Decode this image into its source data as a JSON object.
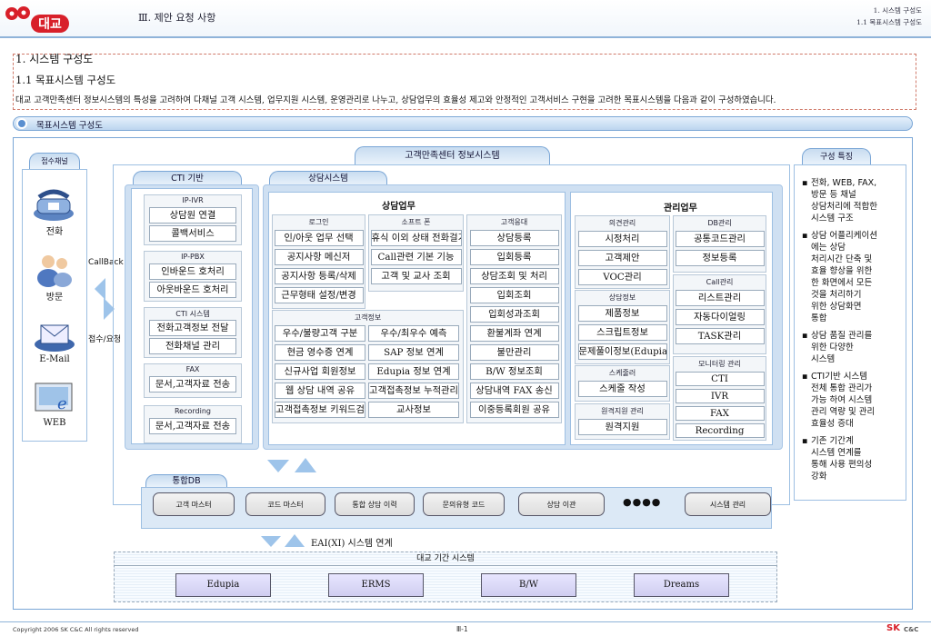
{
  "header": {
    "title": "Ⅲ. 제안 요청 사항",
    "right1": "1. 시스템 구성도",
    "right2": "1.1 목표시스템 구성도"
  },
  "intro": {
    "h1": "1. 시스템 구성도",
    "h2": "1.1 목표시스템 구성도",
    "para": "대교 고객만족센터 정보시스템의 특성을 고려하여 다채널 고객 시스템, 업무지원 시스템, 운영관리로 나누고, 상담업무의 효율성 제고와 안정적인 고객서비스 구현을 고려한 목표시스템을 다음과 같이 구성하였습니다."
  },
  "section_label": "목표시스템 구성도",
  "channels": {
    "title": "접수채널",
    "phone": "전화",
    "visit": "방문",
    "email": "E-Mail",
    "web": "WEB",
    "callback": "CallBack",
    "receive": "접수/요청"
  },
  "main_title": "고객만족센터 정보시스템",
  "cti": {
    "title": "CTI 기반",
    "groups": [
      {
        "name": "IP-IVR",
        "items": [
          "상담원 연결",
          "콜백서비스"
        ]
      },
      {
        "name": "IP-PBX",
        "items": [
          "인바운드 호처리",
          "아웃바운드 호처리"
        ]
      },
      {
        "name": "CTI 시스템",
        "items": [
          "전화고객정보 전달",
          "전화채널 관리"
        ]
      },
      {
        "name": "FAX",
        "items": [
          "문서,고객자료 전송"
        ]
      },
      {
        "name": "Recording",
        "items": [
          "문서,고객자료 전송"
        ]
      }
    ]
  },
  "counsel": {
    "title": "상담시스템",
    "work_title": "상담업무",
    "mgmt_title": "관리업무",
    "login": {
      "name": "로그인",
      "items": [
        "인/아웃 업무 선택",
        "공지사항 메신저",
        "공지사항 등록/삭제",
        "근무형태 설정/변경"
      ]
    },
    "softphone": {
      "name": "소프트 폰",
      "items": [
        "휴식 이외 상태 전화걸기",
        "Call관련 기본 기능",
        "고객 및 교사 조회"
      ]
    },
    "customer_info": {
      "name": "고객정보",
      "rows": [
        [
          "우수/불량고객 구분",
          "우수/최우수 예측"
        ],
        [
          "현금 영수증 연계",
          "SAP 정보 연계"
        ],
        [
          "신규사업 회원정보",
          "Edupia 정보 연계"
        ],
        [
          "웹 상담 내역 공유",
          "고객접촉정보 누적관리"
        ],
        [
          "고객접촉정보 키워드검색",
          "교사정보"
        ]
      ]
    },
    "response": {
      "name": "고객응대",
      "items": [
        "상담등록",
        "입회등록",
        "상담조회 및 처리",
        "입회조회",
        "입회성과조회",
        "환불계좌 연계",
        "불만관리",
        "B/W 정보조회",
        "상담내역 FAX 송신",
        "이중등록회원 공유"
      ]
    },
    "opinion": {
      "name": "의견관리",
      "items": [
        "시정처리",
        "고객제안",
        "VOC관리"
      ]
    },
    "db_mgmt": {
      "name": "DB관리",
      "items": [
        "공통코드관리",
        "정보등록"
      ]
    },
    "call_mgmt": {
      "name": "Call관리",
      "items": [
        "리스트관리",
        "자동다이얼링",
        "TASK관리"
      ]
    },
    "counsel_info": {
      "name": "상담정보",
      "items": [
        "제품정보",
        "스크립트정보",
        "문제풀이정보(Edupia연계)"
      ]
    },
    "schedule": {
      "name": "스케줄러",
      "items": [
        "스케줄 작성"
      ]
    },
    "remote": {
      "name": "원격지원 관리",
      "items": [
        "원격지원"
      ]
    },
    "monitor": {
      "name": "모니터링 관리",
      "items": [
        "CTI",
        "IVR",
        "FAX",
        "Recording"
      ]
    }
  },
  "integrated_db": {
    "title": "통합DB",
    "items": [
      "고객 마스터",
      "코드 마스터",
      "통합 상담 이력",
      "문의유형 코드",
      "상담 이관",
      "시스템 관리"
    ],
    "ellipsis": "●●●●"
  },
  "eai": "EAI(XI) 시스템 연계",
  "backbone": {
    "title": "대교 기간 시스템",
    "items": [
      "Edupia",
      "ERMS",
      "B/W",
      "Dreams"
    ]
  },
  "features": {
    "title": "구성 특징",
    "bullets": [
      [
        "전화, WEB, FAX,",
        "방문 등 채널",
        "상담처리에 적합한",
        "시스템 구조"
      ],
      [
        "상담 어플리케이션",
        "에는 상담",
        "처리시간 단축 및",
        "효율 향상을 위한",
        "한 화면에서 모든",
        "것을 처리하기",
        "위한 상담화면",
        "통합"
      ],
      [
        "상담 품질 관리를",
        "위한 다양한",
        "시스템"
      ],
      [
        "CTI기반 시스템",
        "전체 통합 관리가",
        "가능 하여 시스템",
        "관리 역량 및 관리",
        "효율성 증대"
      ],
      [
        "기존 기간계",
        "시스템 연계를",
        "통해 사용 편의성",
        "강화"
      ]
    ]
  },
  "footer": {
    "copyright": "Copyright 2006 SK C&C All rights reserved",
    "page": "Ⅲ-1",
    "brand_sk": "SK",
    "brand_cc": "C&C"
  },
  "colors": {
    "accent_blue": "#7aa6d6",
    "logo_red": "#d8202a",
    "sys_purple": "#d3d1f2"
  }
}
